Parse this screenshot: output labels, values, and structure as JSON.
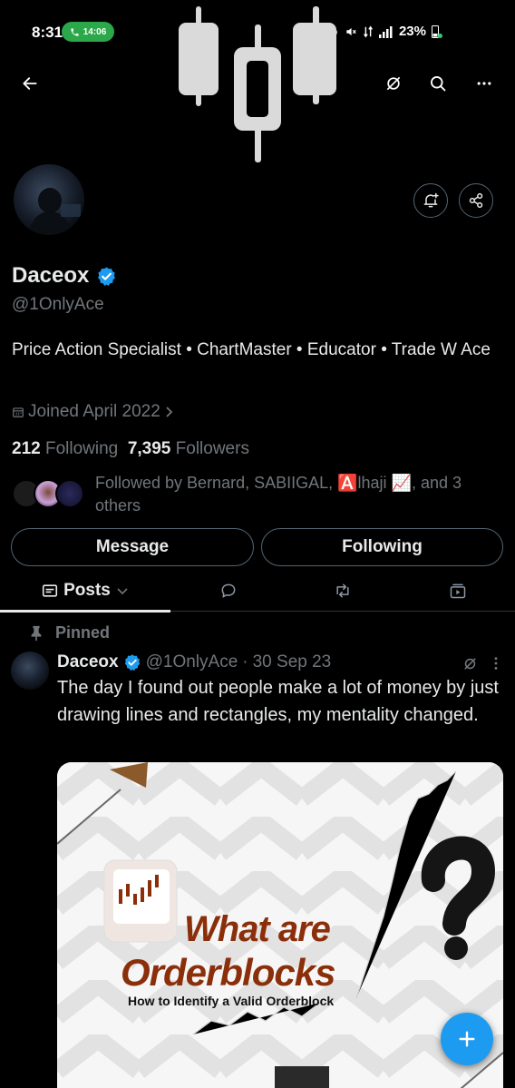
{
  "status_bar": {
    "time": "8:31",
    "call_timer": "14:06",
    "battery": "23%"
  },
  "profile": {
    "name": "Daceox",
    "handle": "@1OnlyAce",
    "bio": "Price Action Specialist  • ChartMaster • Educator • Trade W Ace",
    "joined": "Joined April 2022",
    "following_count": "212",
    "following_label": "Following",
    "followers_count": "7,395",
    "followers_label": "Followers",
    "followed_by": "Followed by Bernard, SABIIGAL, 🅰️lhaji 📈, and 3 others"
  },
  "actions": {
    "message": "Message",
    "following": "Following"
  },
  "tabs": {
    "posts": "Posts"
  },
  "tweet": {
    "pinned_label": "Pinned",
    "author_name": "Daceox",
    "author_handle": "@1OnlyAce",
    "separator": "·",
    "date": "30 Sep 23",
    "text": "The day I found out people make a lot of money by just drawing lines and rectangles, my mentality changed.",
    "media": {
      "title_line1": "What are",
      "title_line2": "Orderblocks",
      "subtitle": "How to Identify a Valid Orderblock",
      "question_mark": "?"
    }
  },
  "colors": {
    "background": "#000000",
    "primary_text": "#e7e9ea",
    "secondary_text": "#71767b",
    "accent": "#1d9bf0",
    "border": "#536471",
    "media_title": "#8b2f0b"
  },
  "icons": {
    "back": "arrow-left-icon",
    "grok": "grok-icon",
    "search": "search-icon",
    "more": "more-icon",
    "notify": "bell-plus-icon",
    "share": "share-icon",
    "verified": "verified-badge-icon",
    "calendar": "calendar-icon",
    "pin": "pin-icon",
    "reply": "reply-icon",
    "repost": "repost-icon",
    "media_tab": "media-icon",
    "compose": "plus-icon"
  }
}
